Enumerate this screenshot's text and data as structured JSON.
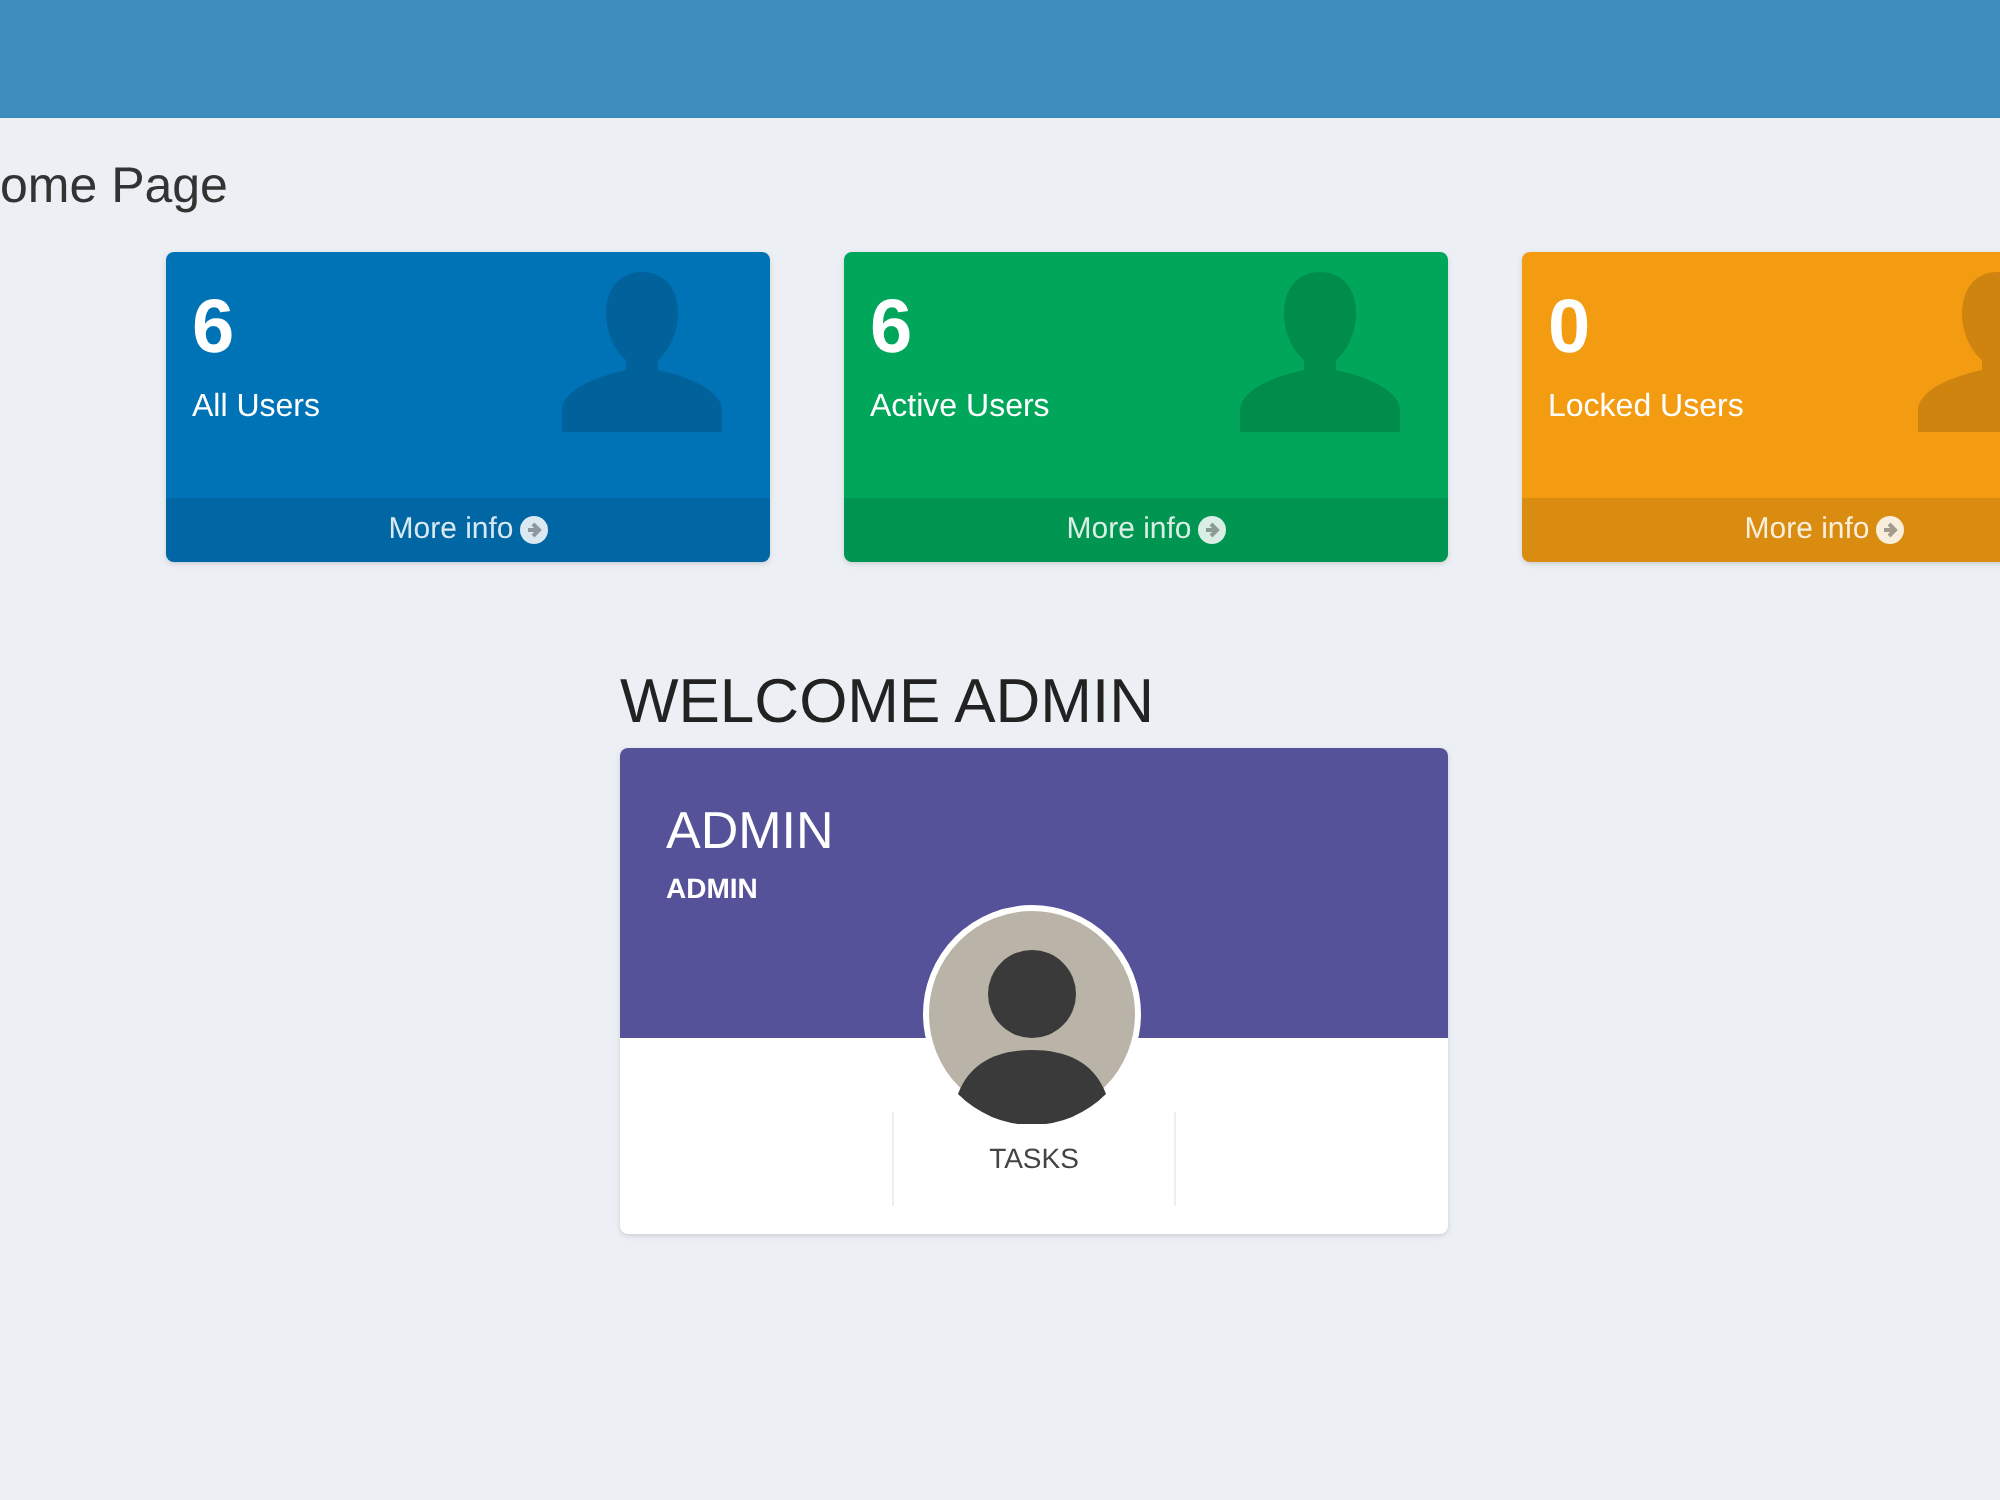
{
  "page_title": "ome Page",
  "stat_cards": [
    {
      "value": "6",
      "label": "All Users",
      "link": "More info",
      "color": "#0073b7"
    },
    {
      "value": "6",
      "label": "Active Users",
      "link": "More info",
      "color": "#00a65a"
    },
    {
      "value": "0",
      "label": "Locked Users",
      "link": "More info",
      "color": "#f39c12"
    }
  ],
  "welcome": {
    "heading": "WELCOME ADMIN",
    "profile": {
      "name": "ADMIN",
      "role": "ADMIN",
      "items": [
        {
          "label": "TASKS"
        }
      ]
    }
  }
}
